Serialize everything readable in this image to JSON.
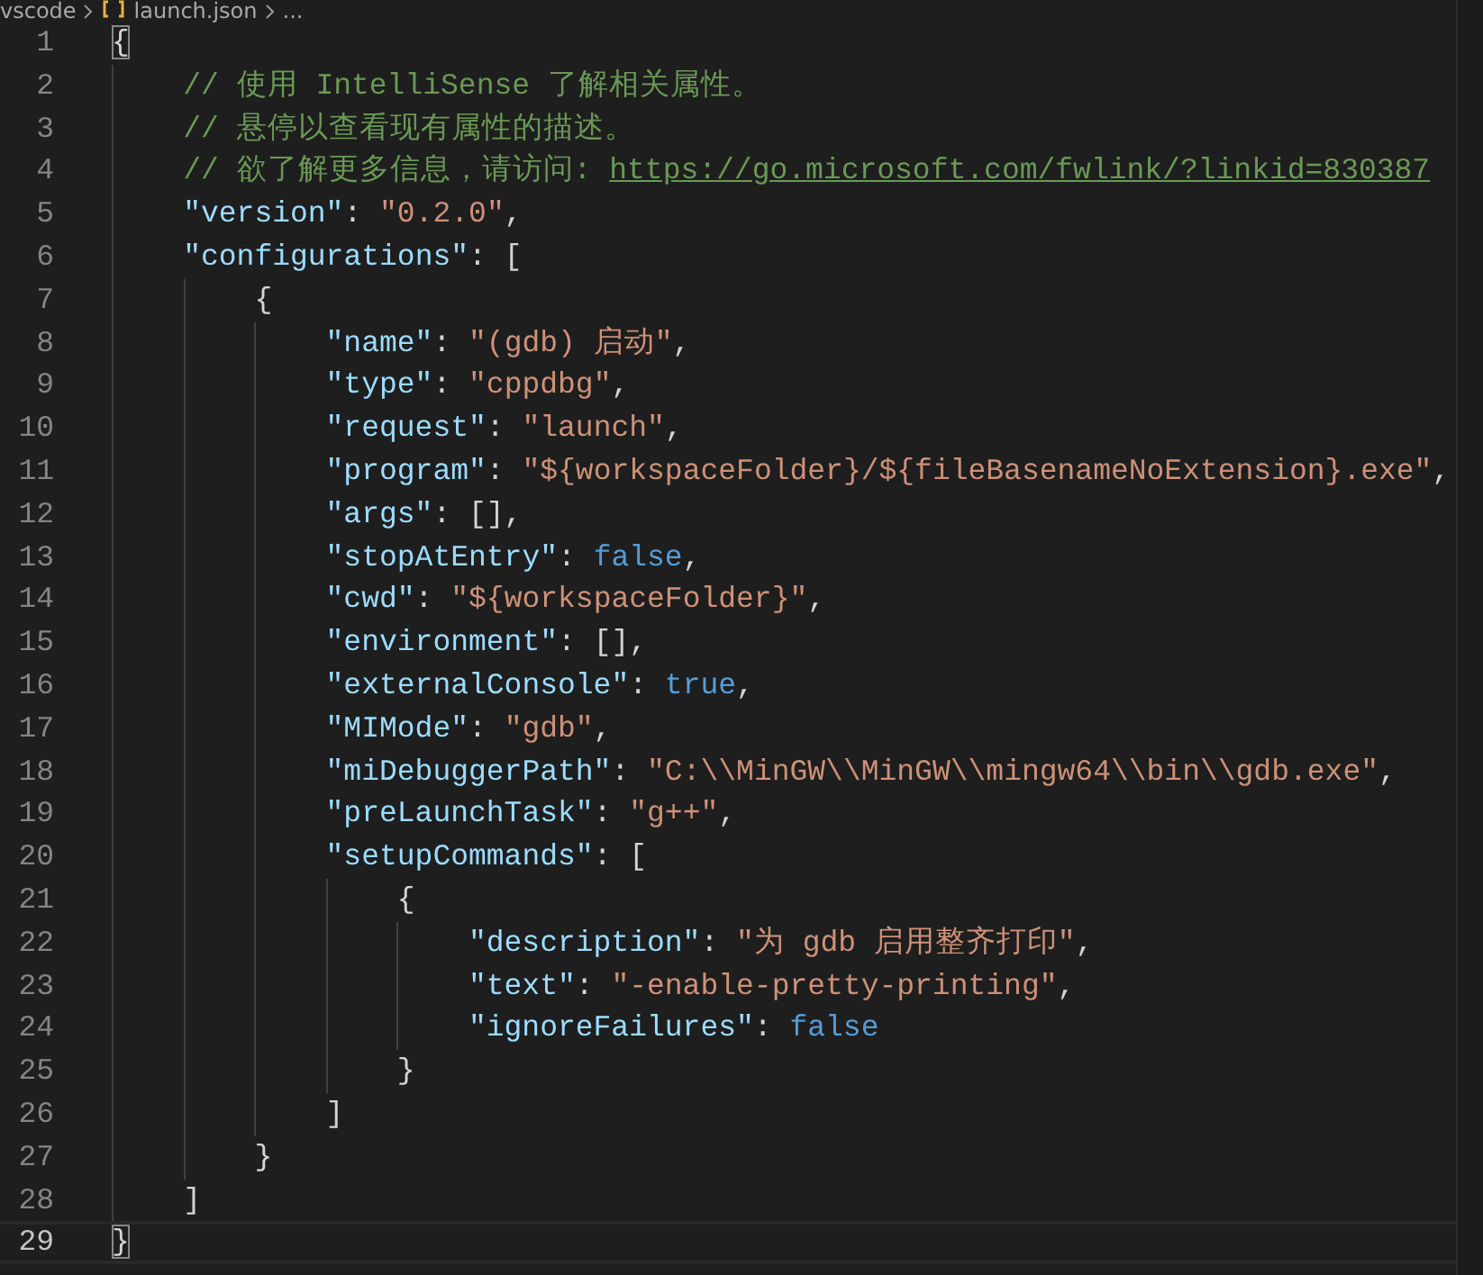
{
  "breadcrumb": {
    "items": [
      {
        "text": "vscode",
        "kind": "folder"
      },
      {
        "text": "launch.json",
        "kind": "file"
      },
      {
        "text": "...",
        "kind": "more"
      }
    ]
  },
  "editor": {
    "lines": [
      {
        "number": "1",
        "current": false,
        "tokens": [
          {
            "kind": "bracket-match",
            "text": "{"
          }
        ]
      },
      {
        "number": "2",
        "current": false,
        "tokens": [
          {
            "kind": "comment",
            "text": "    // 使用 IntelliSense 了解相关属性。"
          }
        ]
      },
      {
        "number": "3",
        "current": false,
        "tokens": [
          {
            "kind": "comment",
            "text": "    // 悬停以查看现有属性的描述。"
          }
        ]
      },
      {
        "number": "4",
        "current": false,
        "tokens": [
          {
            "kind": "comment",
            "text": "    // 欲了解更多信息，请访问: "
          },
          {
            "kind": "link",
            "text": "https://go.microsoft.com/fwlink/?linkid=830387"
          }
        ]
      },
      {
        "number": "5",
        "current": false,
        "tokens": [
          {
            "kind": "key",
            "text": "    \"version\""
          },
          {
            "kind": "punct",
            "text": ": "
          },
          {
            "kind": "string",
            "text": "\"0.2.0\""
          },
          {
            "kind": "punct",
            "text": ","
          }
        ]
      },
      {
        "number": "6",
        "current": false,
        "tokens": [
          {
            "kind": "key",
            "text": "    \"configurations\""
          },
          {
            "kind": "punct",
            "text": ": ["
          }
        ]
      },
      {
        "number": "7",
        "current": false,
        "tokens": [
          {
            "kind": "punct",
            "text": "        {"
          }
        ]
      },
      {
        "number": "8",
        "current": false,
        "tokens": [
          {
            "kind": "key",
            "text": "            \"name\""
          },
          {
            "kind": "punct",
            "text": ": "
          },
          {
            "kind": "string",
            "text": "\"(gdb) 启动\""
          },
          {
            "kind": "punct",
            "text": ","
          }
        ]
      },
      {
        "number": "9",
        "current": false,
        "tokens": [
          {
            "kind": "key",
            "text": "            \"type\""
          },
          {
            "kind": "punct",
            "text": ": "
          },
          {
            "kind": "string",
            "text": "\"cppdbg\""
          },
          {
            "kind": "punct",
            "text": ","
          }
        ]
      },
      {
        "number": "10",
        "current": false,
        "tokens": [
          {
            "kind": "key",
            "text": "            \"request\""
          },
          {
            "kind": "punct",
            "text": ": "
          },
          {
            "kind": "string",
            "text": "\"launch\""
          },
          {
            "kind": "punct",
            "text": ","
          }
        ]
      },
      {
        "number": "11",
        "current": false,
        "tokens": [
          {
            "kind": "key",
            "text": "            \"program\""
          },
          {
            "kind": "punct",
            "text": ": "
          },
          {
            "kind": "string",
            "text": "\"${workspaceFolder}/${fileBasenameNoExtension}.exe\""
          },
          {
            "kind": "punct",
            "text": ","
          }
        ]
      },
      {
        "number": "12",
        "current": false,
        "tokens": [
          {
            "kind": "key",
            "text": "            \"args\""
          },
          {
            "kind": "punct",
            "text": ": [],"
          }
        ]
      },
      {
        "number": "13",
        "current": false,
        "tokens": [
          {
            "kind": "key",
            "text": "            \"stopAtEntry\""
          },
          {
            "kind": "punct",
            "text": ": "
          },
          {
            "kind": "keyword",
            "text": "false"
          },
          {
            "kind": "punct",
            "text": ","
          }
        ]
      },
      {
        "number": "14",
        "current": false,
        "tokens": [
          {
            "kind": "key",
            "text": "            \"cwd\""
          },
          {
            "kind": "punct",
            "text": ": "
          },
          {
            "kind": "string",
            "text": "\"${workspaceFolder}\""
          },
          {
            "kind": "punct",
            "text": ","
          }
        ]
      },
      {
        "number": "15",
        "current": false,
        "tokens": [
          {
            "kind": "key",
            "text": "            \"environment\""
          },
          {
            "kind": "punct",
            "text": ": [],"
          }
        ]
      },
      {
        "number": "16",
        "current": false,
        "tokens": [
          {
            "kind": "key",
            "text": "            \"externalConsole\""
          },
          {
            "kind": "punct",
            "text": ": "
          },
          {
            "kind": "keyword",
            "text": "true"
          },
          {
            "kind": "punct",
            "text": ","
          }
        ]
      },
      {
        "number": "17",
        "current": false,
        "tokens": [
          {
            "kind": "key",
            "text": "            \"MIMode\""
          },
          {
            "kind": "punct",
            "text": ": "
          },
          {
            "kind": "string",
            "text": "\"gdb\""
          },
          {
            "kind": "punct",
            "text": ","
          }
        ]
      },
      {
        "number": "18",
        "current": false,
        "tokens": [
          {
            "kind": "key",
            "text": "            \"miDebuggerPath\""
          },
          {
            "kind": "punct",
            "text": ": "
          },
          {
            "kind": "string",
            "text": "\"C:\\\\MinGW\\\\MinGW\\\\mingw64\\\\bin\\\\gdb.exe\""
          },
          {
            "kind": "punct",
            "text": ","
          }
        ]
      },
      {
        "number": "19",
        "current": false,
        "tokens": [
          {
            "kind": "key",
            "text": "            \"preLaunchTask\""
          },
          {
            "kind": "punct",
            "text": ": "
          },
          {
            "kind": "string",
            "text": "\"g++\""
          },
          {
            "kind": "punct",
            "text": ","
          }
        ]
      },
      {
        "number": "20",
        "current": false,
        "tokens": [
          {
            "kind": "key",
            "text": "            \"setupCommands\""
          },
          {
            "kind": "punct",
            "text": ": ["
          }
        ]
      },
      {
        "number": "21",
        "current": false,
        "tokens": [
          {
            "kind": "punct",
            "text": "                {"
          }
        ]
      },
      {
        "number": "22",
        "current": false,
        "tokens": [
          {
            "kind": "key",
            "text": "                    \"description\""
          },
          {
            "kind": "punct",
            "text": ": "
          },
          {
            "kind": "string",
            "text": "\"为 gdb 启用整齐打印\""
          },
          {
            "kind": "punct",
            "text": ","
          }
        ]
      },
      {
        "number": "23",
        "current": false,
        "tokens": [
          {
            "kind": "key",
            "text": "                    \"text\""
          },
          {
            "kind": "punct",
            "text": ": "
          },
          {
            "kind": "string",
            "text": "\"-enable-pretty-printing\""
          },
          {
            "kind": "punct",
            "text": ","
          }
        ]
      },
      {
        "number": "24",
        "current": false,
        "tokens": [
          {
            "kind": "key",
            "text": "                    \"ignoreFailures\""
          },
          {
            "kind": "punct",
            "text": ": "
          },
          {
            "kind": "keyword",
            "text": "false"
          }
        ]
      },
      {
        "number": "25",
        "current": false,
        "tokens": [
          {
            "kind": "punct",
            "text": "                }"
          }
        ]
      },
      {
        "number": "26",
        "current": false,
        "tokens": [
          {
            "kind": "punct",
            "text": "            ]"
          }
        ]
      },
      {
        "number": "27",
        "current": false,
        "tokens": [
          {
            "kind": "punct",
            "text": "        }"
          }
        ]
      },
      {
        "number": "28",
        "current": false,
        "tokens": [
          {
            "kind": "punct",
            "text": "    ]"
          }
        ]
      },
      {
        "number": "29",
        "current": true,
        "tokens": [
          {
            "kind": "bracket-match",
            "text": "}"
          }
        ]
      }
    ]
  }
}
